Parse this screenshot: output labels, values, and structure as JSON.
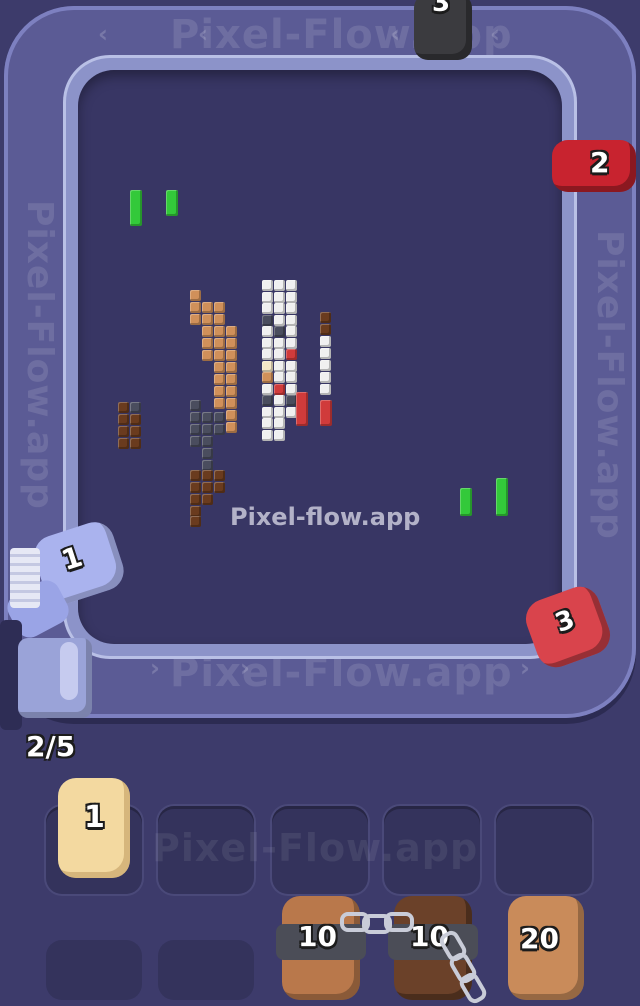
{
  "watermark": {
    "top": "Pixel-Flow.app",
    "bottom": "Pixel-Flow.app",
    "left": "Pixel-Flow.app",
    "right": "Pixel-Flow.app",
    "center": "Pixel-flow.app",
    "slots": "Pixel-Flow.app"
  },
  "belt_shooters": [
    {
      "label": "3",
      "color": "#3b3b3f"
    },
    {
      "label": "2",
      "color": "#c8232f"
    },
    {
      "label": "3",
      "color": "#d9444c"
    },
    {
      "label": "1",
      "color": "#aab3ee"
    }
  ],
  "belt_counter": "2/5",
  "slots": [
    {
      "label": "1",
      "color": "#f3d9a0",
      "filled": true
    },
    {
      "label": "",
      "filled": false
    },
    {
      "label": "",
      "filled": false
    },
    {
      "label": "",
      "filled": false
    },
    {
      "label": "",
      "filled": false
    }
  ],
  "queue": [
    {
      "label": "10",
      "color": "#b9784b",
      "chained": true,
      "locked": true
    },
    {
      "label": "10",
      "color": "#6b4129",
      "chained": true,
      "locked": true
    },
    {
      "label": "20",
      "color": "#c98b5a",
      "chained": false,
      "locked": false
    }
  ],
  "colors": {
    "green": "#33c93a",
    "tan": "#d0905a",
    "dark_brown": "#6a3b1e",
    "white": "#f0f0f0",
    "gray": "#4a4d5e",
    "red": "#d03b3b",
    "cream": "#f6e8c8"
  }
}
